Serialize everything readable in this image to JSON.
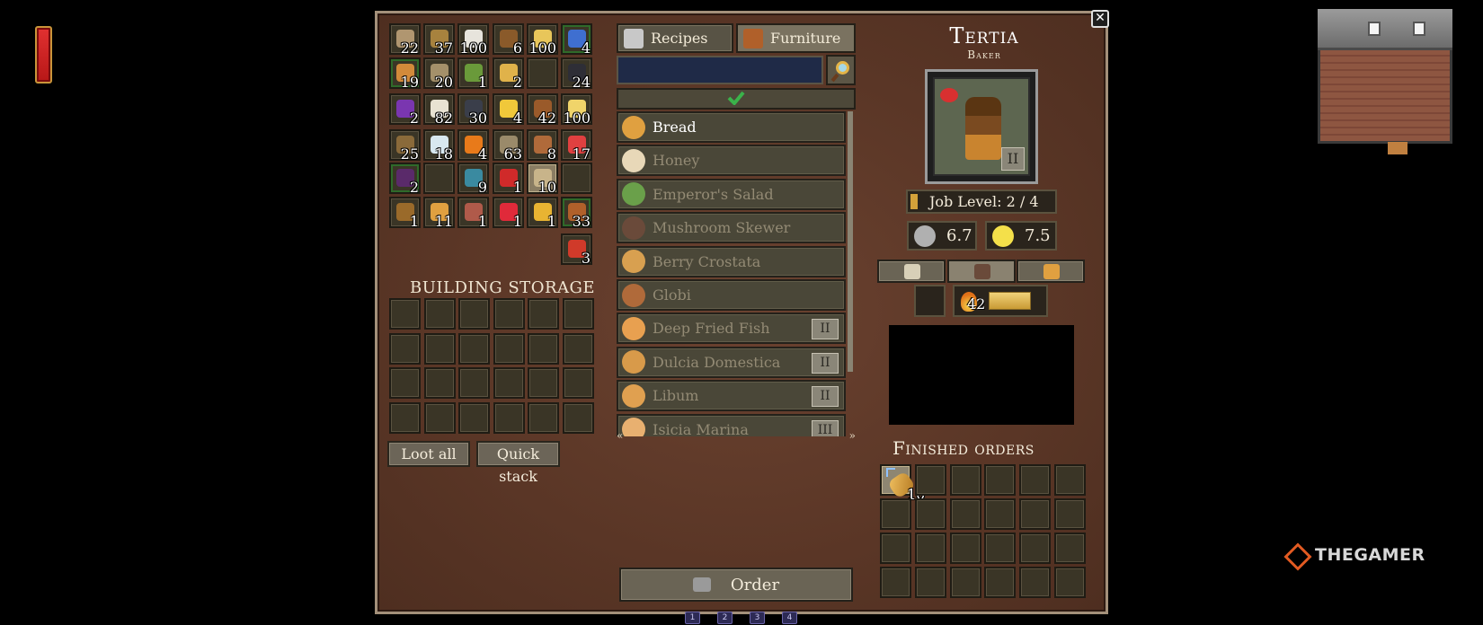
{
  "inventory": [
    {
      "qty": "22",
      "icon": "seeds-icon",
      "color": "#b09670",
      "border": ""
    },
    {
      "qty": "37",
      "icon": "wheat-bundle-icon",
      "color": "#a7823e",
      "border": ""
    },
    {
      "qty": "100",
      "icon": "salt-icon",
      "color": "#e7e4dc",
      "border": ""
    },
    {
      "qty": "6",
      "icon": "stick-icon",
      "color": "#8a5a2a",
      "border": ""
    },
    {
      "qty": "100",
      "icon": "wheat-icon",
      "color": "#e8c65a",
      "border": ""
    },
    {
      "qty": "4",
      "icon": "potion-blue-icon",
      "color": "#3f6fd0",
      "border": "green"
    },
    {
      "qty": "19",
      "icon": "mushroom-icon",
      "color": "#d28a3a",
      "border": "green"
    },
    {
      "qty": "20",
      "icon": "flour-sack-icon",
      "color": "#a4906a",
      "border": ""
    },
    {
      "qty": "1",
      "icon": "palm-sapling-icon",
      "color": "#6a9a3a",
      "border": ""
    },
    {
      "qty": "2",
      "icon": "grain-icon",
      "color": "#e0b24a",
      "border": ""
    },
    {
      "qty": "",
      "icon": "",
      "color": "",
      "border": ""
    },
    {
      "qty": "24",
      "icon": "coal-icon",
      "color": "#2e2e36",
      "border": ""
    },
    {
      "qty": "2",
      "icon": "grapes-icon",
      "color": "#7a36b0",
      "border": ""
    },
    {
      "qty": "82",
      "icon": "bone-icon",
      "color": "#e8e2d2",
      "border": ""
    },
    {
      "qty": "30",
      "icon": "ore-icon",
      "color": "#3a3e4a",
      "border": ""
    },
    {
      "qty": "4",
      "icon": "cheese-icon",
      "color": "#f0c83a",
      "border": ""
    },
    {
      "qty": "42",
      "icon": "leather-icon",
      "color": "#9a5a2a",
      "border": ""
    },
    {
      "qty": "100",
      "icon": "wheat-stalk-icon",
      "color": "#f0d46a",
      "border": ""
    },
    {
      "qty": "25",
      "icon": "pebbles-icon",
      "color": "#8a6a3a",
      "border": ""
    },
    {
      "qty": "18",
      "icon": "flask-icon",
      "color": "#d8e8f0",
      "border": ""
    },
    {
      "qty": "4",
      "icon": "orange-icon",
      "color": "#e87a1a",
      "border": ""
    },
    {
      "qty": "63",
      "icon": "arrow-icon",
      "color": "#9a8a6a",
      "border": ""
    },
    {
      "qty": "8",
      "icon": "chair-icon",
      "color": "#b06a3a",
      "border": ""
    },
    {
      "qty": "17",
      "icon": "meat-icon",
      "color": "#e04040",
      "border": ""
    },
    {
      "qty": "2",
      "icon": "berries-icon",
      "color": "#5a2a6a",
      "border": "green"
    },
    {
      "qty": "",
      "icon": "",
      "color": "",
      "border": ""
    },
    {
      "qty": "9",
      "icon": "dye-icon",
      "color": "#3a8aa0",
      "border": ""
    },
    {
      "qty": "1",
      "icon": "potion-red-icon",
      "color": "#d02a2a",
      "border": ""
    },
    {
      "qty": "10",
      "icon": "bread-loaf-icon",
      "color": "#c8b48a",
      "border": "hl"
    },
    {
      "qty": "",
      "icon": "",
      "color": "",
      "border": ""
    },
    {
      "qty": "1",
      "icon": "small-seeds-icon",
      "color": "#9a6a2a",
      "border": ""
    },
    {
      "qty": "11",
      "icon": "bread-icon",
      "color": "#e0a040",
      "border": ""
    },
    {
      "qty": "1",
      "icon": "steak-icon",
      "color": "#b05a4a",
      "border": ""
    },
    {
      "qty": "1",
      "icon": "health-potion-icon",
      "color": "#e02a3a",
      "border": ""
    },
    {
      "qty": "1",
      "icon": "gold-coin-icon",
      "color": "#e8b432",
      "border": ""
    },
    {
      "qty": "33",
      "icon": "hide-icon",
      "color": "#b0602a",
      "border": "green"
    },
    {
      "qty": "3",
      "icon": "sausage-icon",
      "color": "#d03a2a",
      "border": ""
    }
  ],
  "storage": {
    "label": "BUILDING STORAGE",
    "rows": 4,
    "cols": 6
  },
  "buttons": {
    "loot_all": "Loot all",
    "quick_stack": "Quick stack",
    "order": "Order"
  },
  "tabs": [
    {
      "label": "Recipes",
      "icon": "recipes-icon",
      "active": false
    },
    {
      "label": "Furniture",
      "icon": "furniture-chest-icon",
      "active": true
    }
  ],
  "search": {
    "value": "",
    "placeholder": ""
  },
  "recipes": [
    {
      "name": "Bread",
      "icon": "bread-icon",
      "color": "#e0a040",
      "tier": "",
      "selected": true
    },
    {
      "name": "Honey",
      "icon": "honey-jar-icon",
      "color": "#e8d8b8",
      "tier": "",
      "selected": false
    },
    {
      "name": "Emperor's Salad",
      "icon": "salad-icon",
      "color": "#6aa04a",
      "tier": "",
      "selected": false
    },
    {
      "name": "Mushroom Skewer",
      "icon": "skewer-icon",
      "color": "#6a4a3a",
      "tier": "",
      "selected": false
    },
    {
      "name": "Berry Crostata",
      "icon": "crostata-icon",
      "color": "#d8a050",
      "tier": "",
      "selected": false
    },
    {
      "name": "Globi",
      "icon": "globi-icon",
      "color": "#b06a3a",
      "tier": "",
      "selected": false
    },
    {
      "name": "Deep Fried Fish",
      "icon": "fried-fish-icon",
      "color": "#e8a050",
      "tier": "II",
      "selected": false
    },
    {
      "name": "Dulcia Domestica",
      "icon": "dulcia-icon",
      "color": "#d89a4a",
      "tier": "II",
      "selected": false
    },
    {
      "name": "Libum",
      "icon": "libum-icon",
      "color": "#e0a050",
      "tier": "II",
      "selected": false
    },
    {
      "name": "Isicia Marina",
      "icon": "isicia-icon",
      "color": "#e8b070",
      "tier": "III",
      "selected": false
    }
  ],
  "npc": {
    "name": "Tertia",
    "role": "Baker",
    "portrait_tier": "II",
    "job_level": "Job Level: 2 / 4",
    "job_level_fraction": 0.5,
    "stats": [
      {
        "value": "6.7",
        "icon": "gear-icon",
        "color": "#b0b0b0"
      },
      {
        "value": "7.5",
        "icon": "starburst-icon",
        "color": "#f4e04a"
      }
    ],
    "subtabs": [
      {
        "icon": "scroll-icon",
        "color": "#d8d0b8",
        "active": false
      },
      {
        "icon": "villager-icon",
        "color": "#6a4a3a",
        "active": true
      },
      {
        "icon": "house-icon",
        "color": "#e0a040",
        "active": false
      }
    ],
    "fuel": {
      "value": "42",
      "fraction": 0.75
    }
  },
  "finished_orders": {
    "label": "Finished orders",
    "rows": 4,
    "cols": 6,
    "first_slot_qty": "10"
  },
  "hotbar": [
    "1",
    "2",
    "3",
    "4"
  ]
}
